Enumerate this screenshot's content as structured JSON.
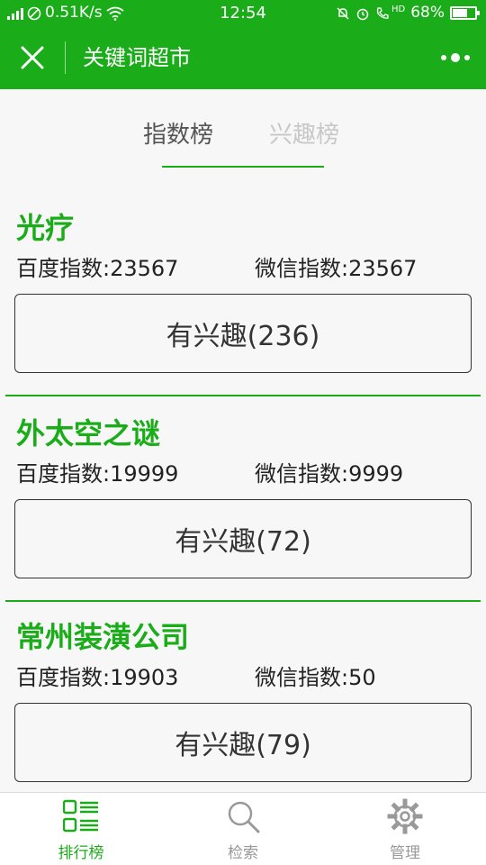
{
  "status_bar": {
    "network": "0.51K/s",
    "time": "12:54",
    "hd": "HD",
    "battery": "68%",
    "battery_level": 0.68,
    "network_icon": "signal-icon",
    "battery_icon": "battery-icon"
  },
  "header": {
    "title": "关键词超市",
    "close_icon": "close-icon",
    "more_icon": "more-icon"
  },
  "tabs": [
    {
      "label": "指数榜",
      "active": true
    },
    {
      "label": "兴趣榜",
      "active": false
    }
  ],
  "items": [
    {
      "title": "光疗",
      "baidu_index": "百度指数:23567",
      "weixin_index": "微信指数:23567",
      "interest_button": "有兴趣(236)"
    },
    {
      "title": "外太空之谜",
      "baidu_index": "百度指数:19999",
      "weixin_index": "微信指数:9999",
      "interest_button": "有兴趣(72)"
    },
    {
      "title": "常州装潢公司",
      "baidu_index": "百度指数:19903",
      "weixin_index": "微信指数:50",
      "interest_button": "有兴趣(79)"
    }
  ],
  "bottom_nav": [
    {
      "label": "排行榜",
      "icon": "ranking-list-icon",
      "active": true
    },
    {
      "label": "检索",
      "icon": "search-icon",
      "active": false
    },
    {
      "label": "管理",
      "icon": "gear-icon",
      "active": false
    }
  ],
  "colors": {
    "brand_green": "#1aad19",
    "background": "#f7f7f7",
    "inactive_tab": "#c8c8c8"
  }
}
